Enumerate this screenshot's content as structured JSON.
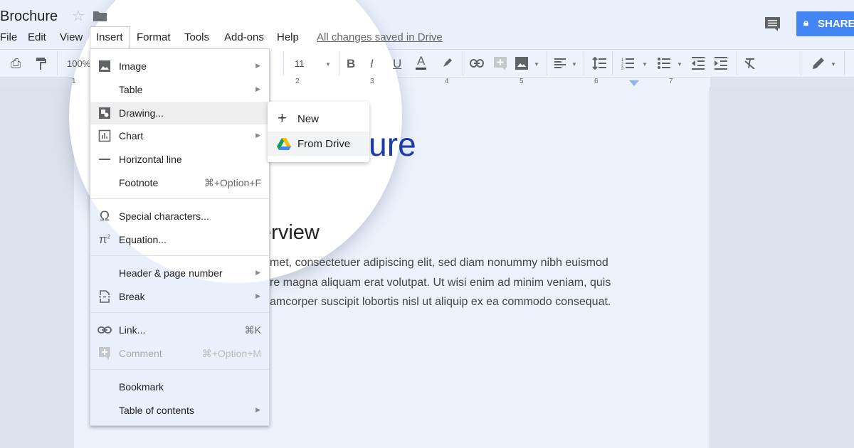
{
  "doc": {
    "title": "Brochure",
    "save_status": "All changes saved in Drive"
  },
  "menubar": [
    "File",
    "Edit",
    "View",
    "Insert",
    "Format",
    "Tools",
    "Add-ons",
    "Help"
  ],
  "share_label": "SHARE",
  "toolbar": {
    "zoom": "100%",
    "font_size": "11",
    "bold": "B",
    "italic": "I",
    "underline": "U",
    "text_color": "A"
  },
  "ruler": [
    "1",
    "2",
    "3",
    "4",
    "5",
    "6",
    "7"
  ],
  "insert_menu": [
    {
      "label": "Image",
      "icon": "image-icon",
      "submenu": true
    },
    {
      "label": "Table",
      "submenu": true
    },
    {
      "label": "Drawing...",
      "icon": "drawing-icon",
      "highlighted": true
    },
    {
      "label": "Chart",
      "icon": "chart-icon",
      "submenu": true
    },
    {
      "label": "Horizontal line",
      "icon": "horizontal-line-icon"
    },
    {
      "label": "Footnote",
      "shortcut": "⌘+Option+F"
    },
    {
      "label": "Special characters...",
      "icon": "omega-icon"
    },
    {
      "label": "Equation...",
      "icon": "pi-icon"
    },
    {
      "label": "Header & page number",
      "submenu": true
    },
    {
      "label": "Break",
      "icon": "page-break-icon",
      "submenu": true
    },
    {
      "label": "Link...",
      "icon": "link-icon",
      "shortcut": "⌘K"
    },
    {
      "label": "Comment",
      "icon": "add-comment-icon",
      "shortcut": "⌘+Option+M",
      "disabled": true
    },
    {
      "label": "Bookmark"
    },
    {
      "label": "Table of contents",
      "submenu": true
    }
  ],
  "drawing_submenu": [
    {
      "label": "New",
      "icon": "plus-icon"
    },
    {
      "label": "From Drive",
      "icon": "google-drive-icon",
      "highlighted": true
    }
  ],
  "document": {
    "title": "Brochure",
    "heading": "Overview",
    "lines": [
      "met, consectetuer adipiscing elit, sed diam nonummy nibh euismod",
      "re magna aliquam erat volutpat. Ut wisi enim ad minim veniam, quis",
      "amcorper suscipit lobortis nisl ut aliquip ex ea commodo consequat."
    ]
  },
  "colors": {
    "share": "#4285f4",
    "title": "#1c3aa9",
    "highlight": "#eeeeee"
  }
}
